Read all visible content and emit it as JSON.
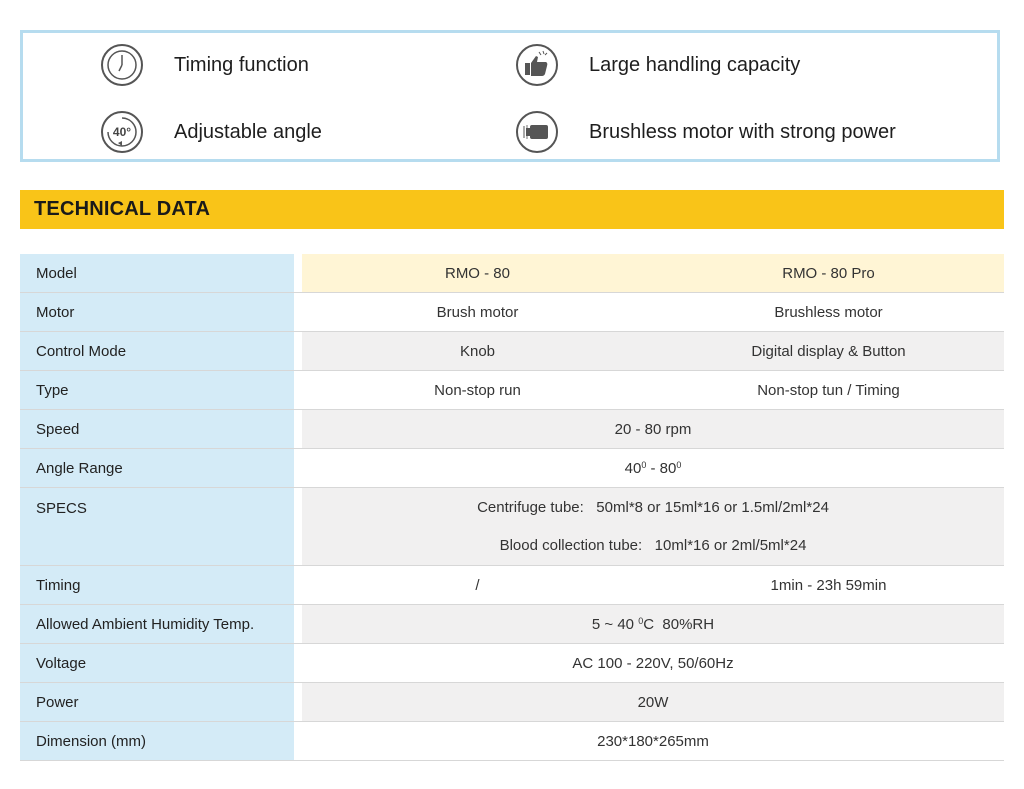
{
  "features": [
    {
      "icon": "clock-icon",
      "label": "Timing function"
    },
    {
      "icon": "thumbs-up-icon",
      "label": "Large handling capacity"
    },
    {
      "icon": "angle-40-icon",
      "icon_text": "40°",
      "label": "Adjustable angle"
    },
    {
      "icon": "motor-icon",
      "label": "Brushless motor with strong power"
    }
  ],
  "section_title": "TECHNICAL DATA",
  "table": {
    "model": {
      "label": "Model",
      "col1": "RMO - 80",
      "col2": "RMO - 80 Pro"
    },
    "motor": {
      "label": "Motor",
      "col1": "Brush motor",
      "col2": "Brushless motor"
    },
    "control": {
      "label": "Control Mode",
      "col1": "Knob",
      "col2": "Digital display & Button"
    },
    "type": {
      "label": "Type",
      "col1": "Non-stop run",
      "col2": "Non-stop tun / Timing"
    },
    "speed": {
      "label": "Speed",
      "value": "20 - 80 rpm"
    },
    "angle": {
      "label": "Angle Range",
      "value_a": "40",
      "deg": "0",
      "value_sep": " - 80",
      "deg2": "0"
    },
    "specs": {
      "label": "SPECS",
      "line1": "Centrifuge tube:   50ml*8 or 15ml*16 or 1.5ml/2ml*24",
      "line2": "Blood collection tube:   10ml*16 or 2ml/5ml*24"
    },
    "timing": {
      "label": "Timing",
      "col1": "/",
      "col2": "1min - 23h 59min"
    },
    "ambient": {
      "label": "Allowed Ambient Humidity Temp.",
      "value_a": "5 ~ 40 ",
      "deg": "0",
      "value_b": "C  80%RH"
    },
    "voltage": {
      "label": "Voltage",
      "value": "AC 100 - 220V, 50/60Hz"
    },
    "power": {
      "label": "Power",
      "value": "20W"
    },
    "dimension": {
      "label": "Dimension (mm)",
      "value": "230*180*265mm"
    }
  }
}
